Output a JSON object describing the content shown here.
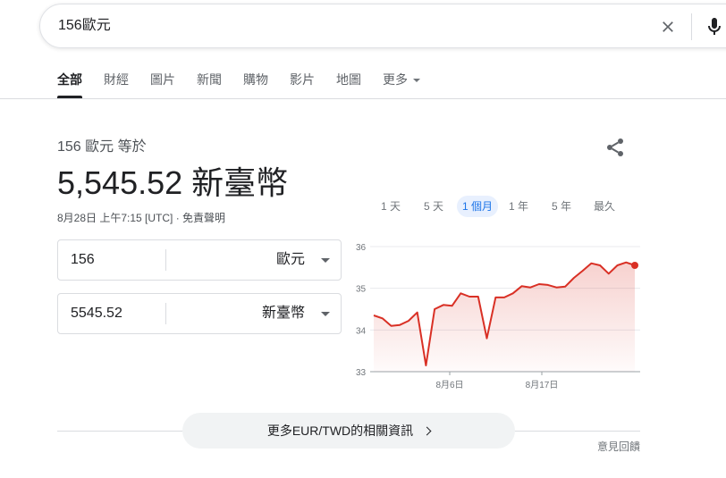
{
  "search": {
    "query": "156歐元"
  },
  "tabs": [
    {
      "label": "全部",
      "active": true
    },
    {
      "label": "財經"
    },
    {
      "label": "圖片"
    },
    {
      "label": "新聞"
    },
    {
      "label": "購物"
    },
    {
      "label": "影片"
    },
    {
      "label": "地圖"
    },
    {
      "label": "更多"
    }
  ],
  "converter": {
    "subtitle": "156 歐元 等於",
    "result": "5,545.52 新臺幣",
    "timestamp": "8月28日 上午7:15 [UTC] · 免責聲明",
    "from": {
      "value": "156",
      "currency": "歐元"
    },
    "to": {
      "value": "5545.52",
      "currency": "新臺幣"
    }
  },
  "ranges": [
    {
      "label": "1 天"
    },
    {
      "label": "5 天"
    },
    {
      "label": "1 個月",
      "active": true
    },
    {
      "label": "1 年"
    },
    {
      "label": "5 年"
    },
    {
      "label": "最久"
    }
  ],
  "chart_data": {
    "type": "area",
    "yticks": [
      "36",
      "35",
      "34",
      "33"
    ],
    "xticks": [
      "8月6日",
      "8月17日"
    ],
    "ylim": [
      33,
      36
    ],
    "color": "#d93025",
    "values": [
      34.35,
      34.28,
      34.1,
      34.12,
      34.22,
      34.42,
      33.15,
      34.5,
      34.6,
      34.58,
      34.88,
      34.8,
      34.8,
      33.8,
      34.78,
      34.78,
      34.88,
      35.05,
      35.02,
      35.1,
      35.08,
      35.02,
      35.04,
      35.25,
      35.42,
      35.6,
      35.55,
      35.35,
      35.55,
      35.62,
      35.55
    ]
  },
  "more_info": "更多EUR/TWD的相關資訊",
  "feedback": "意見回饋",
  "colors": {
    "accent": "#1a73e8",
    "series": "#d93025"
  }
}
